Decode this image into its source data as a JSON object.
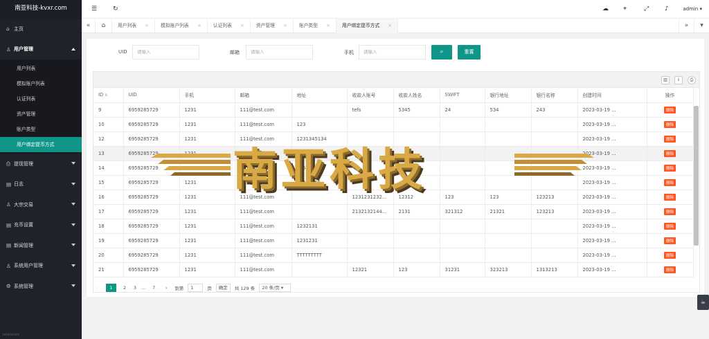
{
  "brand": "南亚科技-kvxr.com",
  "sidebar": {
    "home": "主页",
    "user_mgmt": "用户管理",
    "sub": [
      "用户列表",
      "模拟账户列表",
      "认证列表",
      "资产管理",
      "账户类型",
      "用户绑定提币方式"
    ],
    "groups": [
      "提现管理",
      "日志",
      "大宗交易",
      "充币设置",
      "新闻管理",
      "系统用户管理",
      "系统管理"
    ],
    "footer": "jatatatjstr"
  },
  "topbar": {
    "user": "admin"
  },
  "tabs": [
    "用户列表",
    "模拟账户列表",
    "认证列表",
    "资产管理",
    "账户类型",
    "用户绑定提币方式"
  ],
  "search": {
    "uid_label": "UID",
    "uid_placeholder": "请输入",
    "email_label": "邮箱",
    "email_placeholder": "请输入",
    "phone_label": "手机",
    "phone_placeholder": "请输入",
    "reset": "重置"
  },
  "table": {
    "headers": [
      "ID",
      "UID",
      "手机",
      "邮箱",
      "地址",
      "收款人账号",
      "收款人姓名",
      "SWIFT",
      "银行地址",
      "银行名称",
      "创建时间",
      "操作"
    ],
    "rows": [
      [
        "9",
        "6959285729",
        "1231",
        "111@test.com",
        "",
        "tefs",
        "5345",
        "24",
        "534",
        "243",
        "2023-03-19 ...",
        "删除"
      ],
      [
        "10",
        "6959285729",
        "1231",
        "111@test.com",
        "123",
        "",
        "",
        "",
        "",
        "",
        "2023-03-19 ...",
        "删除"
      ],
      [
        "12",
        "6959285729",
        "1231",
        "111@test.com",
        "1231345134",
        "",
        "",
        "",
        "",
        "",
        "2023-03-19 ...",
        "删除"
      ],
      [
        "13",
        "6959285729",
        "1231",
        "111@test.com",
        "1231345134",
        "",
        "",
        "",
        "",
        "",
        "2023-03-19 ...",
        "删除"
      ],
      [
        "14",
        "6959285729",
        "1231",
        "111@test.com",
        "345",
        "",
        "",
        "",
        "",
        "",
        "2023-03-19 ...",
        "删除"
      ],
      [
        "15",
        "6959285729",
        "1231",
        "111@test.com",
        "23423455",
        "",
        "",
        "",
        "",
        "",
        "2023-03-19 ...",
        "删除"
      ],
      [
        "16",
        "6959285729",
        "1231",
        "111@test.com",
        "",
        "1231231232...",
        "12312",
        "123",
        "123",
        "123213",
        "2023-03-19 ...",
        "删除"
      ],
      [
        "17",
        "6959285729",
        "1231",
        "111@test.com",
        "",
        "2132132144...",
        "2131",
        "321312",
        "21321",
        "123213",
        "2023-03-19 ...",
        "删除"
      ],
      [
        "18",
        "6959285729",
        "1231",
        "111@test.com",
        "1232131",
        "",
        "",
        "",
        "",
        "",
        "2023-03-19 ...",
        "删除"
      ],
      [
        "19",
        "6959285729",
        "1231",
        "111@test.com",
        "1231231",
        "",
        "",
        "",
        "",
        "",
        "2023-03-19 ...",
        "删除"
      ],
      [
        "20",
        "6959285729",
        "1231",
        "111@test.com",
        "TTTTTTTTT",
        "",
        "",
        "",
        "",
        "",
        "2023-03-19 ...",
        "删除"
      ],
      [
        "21",
        "6959285729",
        "1231",
        "111@test.com",
        "",
        "12321",
        "123",
        "31231",
        "323213",
        "1313213",
        "2023-03-19 ...",
        "删除"
      ]
    ]
  },
  "pager": {
    "pages": [
      "1",
      "2",
      "3",
      "...",
      "7"
    ],
    "goto_label": "到第",
    "goto_value": "1",
    "page_unit": "页",
    "confirm": "确定",
    "total": "共 129 条",
    "per_page": "20 条/页"
  },
  "watermark": "南亚科技",
  "colors": {
    "accent": "#0f9688",
    "danger": "#ff5722",
    "sidebar": "#20222a"
  }
}
